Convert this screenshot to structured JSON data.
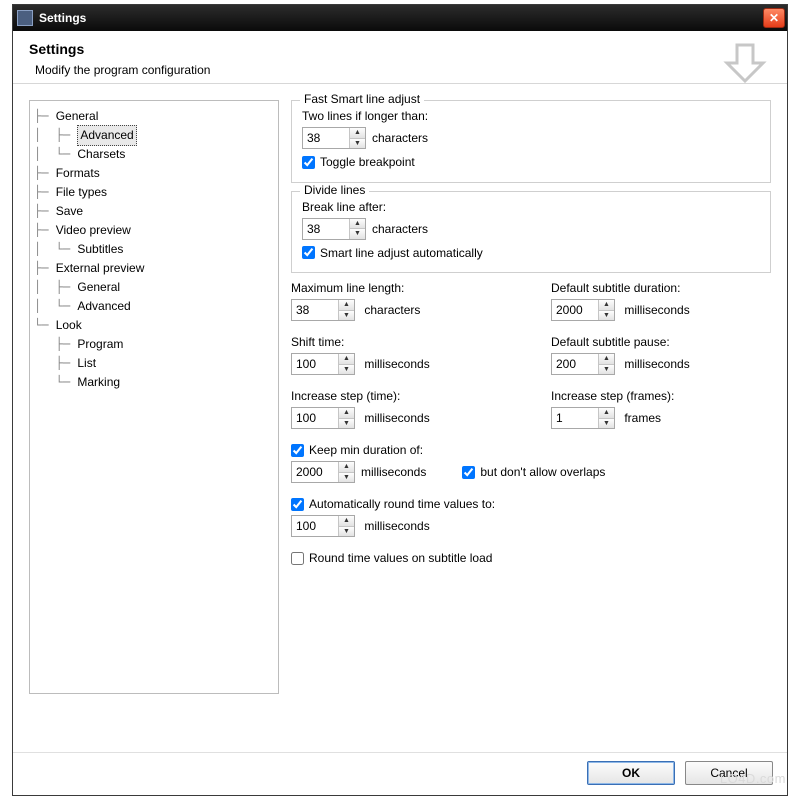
{
  "titlebar": {
    "title": "Settings"
  },
  "header": {
    "title": "Settings",
    "subtitle": "Modify the program configuration"
  },
  "tree": {
    "items": [
      {
        "label": "General",
        "depth": 0
      },
      {
        "label": "Advanced",
        "depth": 1,
        "selected": true
      },
      {
        "label": "Charsets",
        "depth": 1
      },
      {
        "label": "Formats",
        "depth": 0
      },
      {
        "label": "File types",
        "depth": 0
      },
      {
        "label": "Save",
        "depth": 0
      },
      {
        "label": "Video preview",
        "depth": 0
      },
      {
        "label": "Subtitles",
        "depth": 1
      },
      {
        "label": "External preview",
        "depth": 0
      },
      {
        "label": "General",
        "depth": 1
      },
      {
        "label": "Advanced",
        "depth": 1
      },
      {
        "label": "Look",
        "depth": 0
      },
      {
        "label": "Program",
        "depth": 1
      },
      {
        "label": "List",
        "depth": 1
      },
      {
        "label": "Marking",
        "depth": 1
      }
    ]
  },
  "fast_smart": {
    "legend": "Fast Smart line adjust",
    "two_lines_label": "Two lines if longer than:",
    "two_lines_value": "38",
    "two_lines_unit": "characters",
    "toggle_breakpoint_label": "Toggle breakpoint",
    "toggle_breakpoint_checked": true
  },
  "divide_lines": {
    "legend": "Divide lines",
    "break_after_label": "Break line after:",
    "break_after_value": "38",
    "break_after_unit": "characters",
    "smart_auto_label": "Smart line adjust automatically",
    "smart_auto_checked": true
  },
  "max_line_length": {
    "label": "Maximum line length:",
    "value": "38",
    "unit": "characters"
  },
  "default_duration": {
    "label": "Default subtitle duration:",
    "value": "2000",
    "unit": "milliseconds"
  },
  "shift_time": {
    "label": "Shift time:",
    "value": "100",
    "unit": "milliseconds"
  },
  "default_pause": {
    "label": "Default subtitle pause:",
    "value": "200",
    "unit": "milliseconds"
  },
  "inc_step_time": {
    "label": "Increase step (time):",
    "value": "100",
    "unit": "milliseconds"
  },
  "inc_step_frames": {
    "label": "Increase step (frames):",
    "value": "1",
    "unit": "frames"
  },
  "keep_min": {
    "check_label": "Keep min duration of:",
    "checked": true,
    "value": "2000",
    "unit": "milliseconds",
    "no_overlap_label": "but don't allow overlaps",
    "no_overlap_checked": true
  },
  "auto_round": {
    "check_label": "Automatically round time values to:",
    "checked": true,
    "value": "100",
    "unit": "milliseconds"
  },
  "round_on_load": {
    "label": "Round time values on subtitle load",
    "checked": false
  },
  "buttons": {
    "ok": "OK",
    "cancel": "Cancel"
  },
  "watermark": "LO4D.com"
}
